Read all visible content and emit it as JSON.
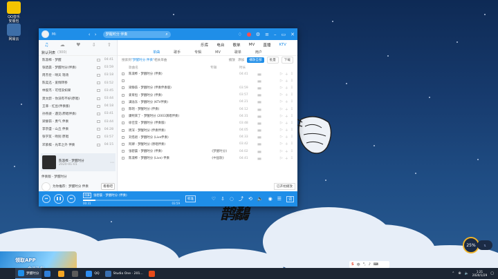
{
  "desktop": {
    "icons": [
      {
        "label": "QQ音乐",
        "sub": "安装包"
      },
      {
        "label": "网易云",
        "sub": "音乐"
      }
    ]
  },
  "app": {
    "title_user": "Mi",
    "search": {
      "value": "梦醒时分 伴奏"
    },
    "nav": [
      {
        "label": "乐库",
        "active": false
      },
      {
        "label": "电台",
        "active": false
      },
      {
        "label": "歌单",
        "active": false
      },
      {
        "label": "MV",
        "active": false
      },
      {
        "label": "直播",
        "active": false
      },
      {
        "label": "KTV",
        "active": true
      }
    ],
    "subtabs": [
      {
        "label": "单曲",
        "active": true
      },
      {
        "label": "歌手",
        "active": false
      },
      {
        "label": "专辑",
        "active": false
      },
      {
        "label": "MV",
        "active": false
      },
      {
        "label": "歌单",
        "active": false
      },
      {
        "label": "用户",
        "active": false
      }
    ],
    "left": {
      "tabs": [
        "♫",
        "☁",
        "♥",
        "⇩",
        "⇧"
      ],
      "list_title": "默认列表",
      "list_count": "(300)",
      "songs": [
        {
          "title": "陈淑桦 - 梦醒",
          "duration": "04:41"
        },
        {
          "title": "张碧晨 - 梦醒时分(伴奏)",
          "duration": "03:59"
        },
        {
          "title": "周杰伦 - 晴天 现场",
          "duration": "03:18"
        },
        {
          "title": "陈奕迅 - 爱情转移",
          "duration": "03:52"
        },
        {
          "title": "林俊杰 - 可惜没如果",
          "duration": "03:45"
        },
        {
          "title": "莫文蔚 - 你没有不好(原唱)",
          "duration": "03:44"
        },
        {
          "title": "王菲 - 红豆(伴奏版)",
          "duration": "04:18"
        },
        {
          "title": "孙燕姿 - 遇见(原唱伴奏)",
          "duration": "03:41"
        },
        {
          "title": "梁静茹 - 勇气 伴奏",
          "duration": "03:44"
        },
        {
          "title": "李宗盛 - 山丘 伴奏",
          "duration": "04:28"
        },
        {
          "title": "张学友 - 吻别 原唱",
          "duration": "03:57"
        },
        {
          "title": "邓紫棋 - 光年之外 伴奏",
          "duration": "04:15"
        }
      ],
      "now_playing": {
        "title": "陈淑桦 - 梦醒时分",
        "sub": "2020-01-01"
      },
      "extra_row": "伴奏版 - 梦醒时分",
      "recommend": {
        "text": "为你推荐：梦醒时分 伴奏",
        "button": "看看吧"
      }
    },
    "toolbar": {
      "prefix": "搜索到",
      "keyword": "\"梦醒时分 伴奏\"",
      "suffix": "相关单曲",
      "links": [
        "播放",
        "添加"
      ],
      "play_all": "播放全部",
      "batch": "批量",
      "download": "下载"
    },
    "columns": {
      "title": "歌曲名",
      "album": "专辑",
      "duration": "时长"
    },
    "results": [
      {
        "title": "陈淑桦 - 梦醒时分 (伴奏)",
        "album": "",
        "duration": "04:41"
      },
      {
        "title": "",
        "album": "",
        "duration": ""
      },
      {
        "title": "梁静茹 - 梦醒时分 (伴奏伴奏版)",
        "album": "",
        "duration": "03:59"
      },
      {
        "title": "姜育恒 - 梦醒时分 (伴奏)",
        "album": "",
        "duration": "03:57"
      },
      {
        "title": "满溢东 - 梦醒时分 (KTV伴奏)",
        "album": "",
        "duration": "04:21"
      },
      {
        "title": "陈明 - 梦醒时分 (伴奏)",
        "album": "",
        "duration": "04:12"
      },
      {
        "title": "康熙来了 - 梦醒时分 (2003演唱伴奏)",
        "album": "",
        "duration": "04:31"
      },
      {
        "title": "徐佳莹 - 梦醒时分 (伴奏版)",
        "album": "",
        "duration": "03:48"
      },
      {
        "title": "周深 - 梦醒时分 (伴奏伴奏)",
        "album": "",
        "duration": "04:05"
      },
      {
        "title": "刘惜君 - 梦醒时分 (Live伴奏)",
        "album": "",
        "duration": "04:33"
      },
      {
        "title": "阿肆 - 梦醒时分 (原唱伴奏)",
        "album": "",
        "duration": "03:42"
      },
      {
        "title": "张碧晨 - 梦醒时分 (伴奏)",
        "album": "《梦醒时分》",
        "duration": "04:02"
      },
      {
        "title": "陈淑桦 - 梦醒时分 (Live) 伴奏",
        "album": "《中国歌》",
        "duration": "04:41"
      }
    ],
    "tooltip": "已开始播放",
    "player": {
      "tag": "伴奏",
      "song": "张碧晨 - 梦醒时分 (伴奏)",
      "time_now": "00:31",
      "time_total": "03:59",
      "progress": 0.13,
      "quality": "标准",
      "lyric": "词"
    }
  },
  "taskbar": {
    "items": [
      {
        "label": "梦醒时分",
        "color": "#1f8ee8",
        "active": true
      },
      {
        "label": "",
        "color": "#2f7ed8",
        "active": false
      },
      {
        "label": "",
        "color": "#f5a623",
        "active": false
      },
      {
        "label": "",
        "color": "#5b5b5b",
        "active": false
      },
      {
        "label": "QQ",
        "color": "#2d8cf0",
        "active": false
      },
      {
        "label": "Studio One - 201...",
        "color": "#3a6fb0",
        "active": false
      },
      {
        "label": "",
        "color": "#e64a19",
        "active": false
      }
    ],
    "time": "1:21",
    "date": "2020/1/29"
  },
  "ad": {
    "title": "领取APP",
    "sub": "会员礼包"
  },
  "ime": {
    "label": "中",
    "brand": "S"
  },
  "widget": {
    "value": "25",
    "unit": "%"
  }
}
